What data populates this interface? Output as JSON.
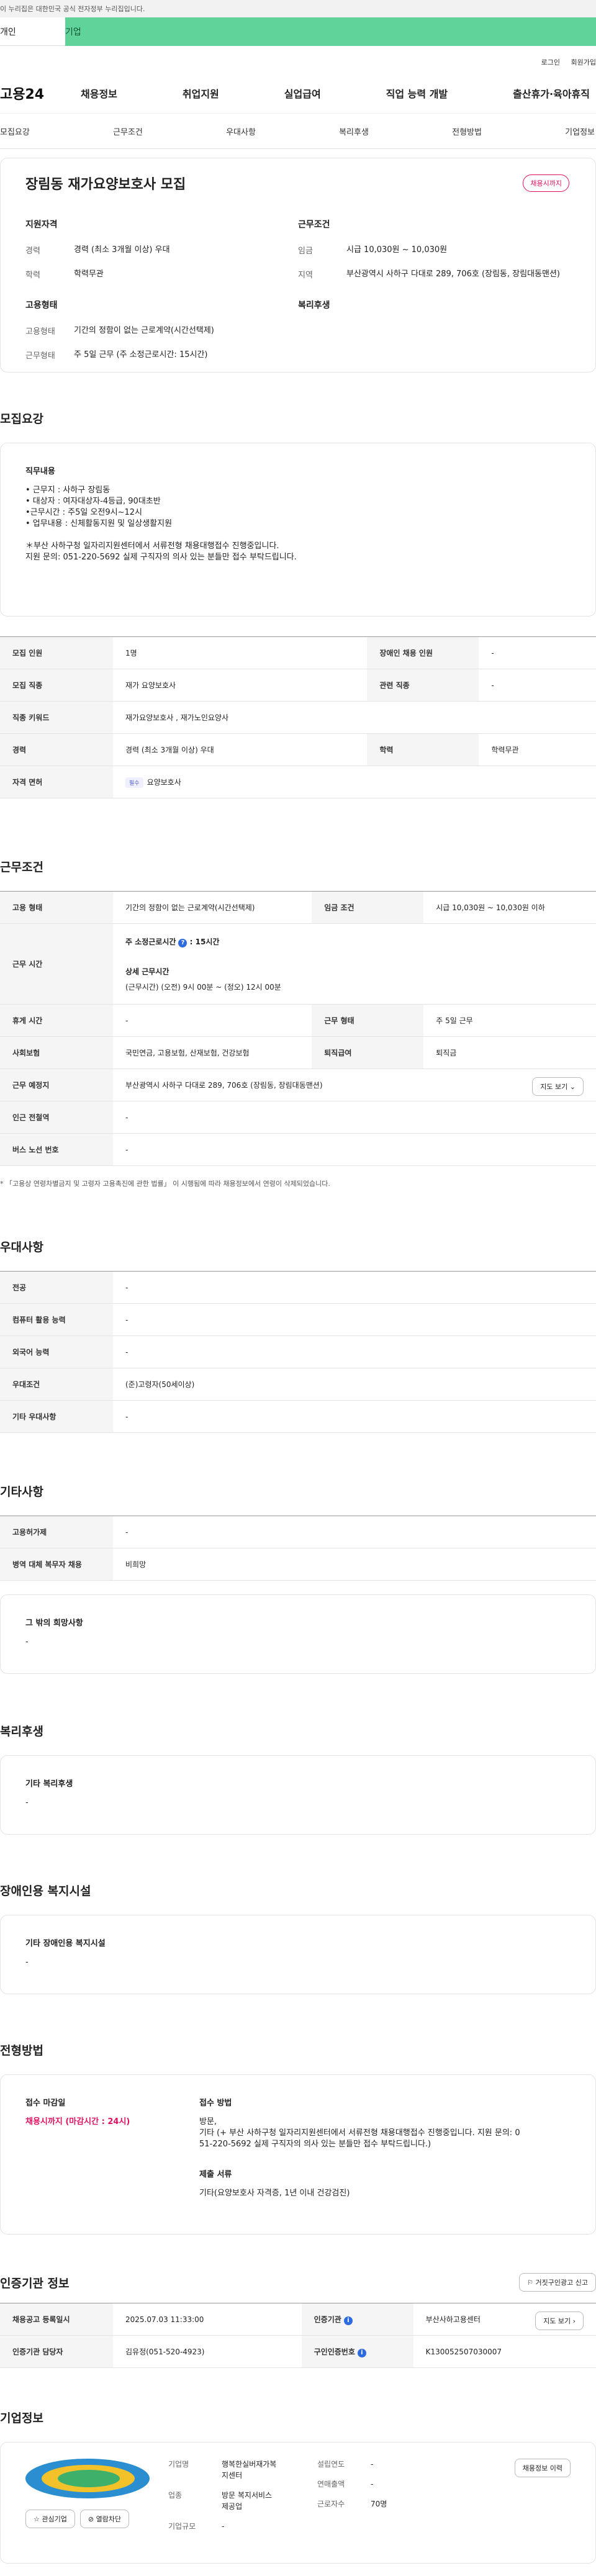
{
  "gov_bar": "이 누리집은 대한민국 공식 전자정부 누리집입니다.",
  "top_tabs": [
    "개인",
    "기업"
  ],
  "util_links": [
    "로그인",
    "회원가입"
  ],
  "logo": "고용24",
  "gnb": [
    "채용정보",
    "취업지원",
    "실업급여",
    "직업 능력 개발",
    "출산휴가·육아휴직"
  ],
  "subnav": [
    "모집요강",
    "근무조건",
    "우대사항",
    "복리후생",
    "전형방법",
    "기업정보"
  ],
  "summary": {
    "title": "장림동 재가요양보호사 모집",
    "badge": "채용시까지",
    "qual_header": "지원자격",
    "qual": [
      {
        "k": "경력",
        "v": "경력 (최소 3개월 이상) 우대"
      },
      {
        "k": "학력",
        "v": "학력무관"
      }
    ],
    "emp_header": "고용형태",
    "emp": [
      {
        "k": "고용형태",
        "v": "기간의 정함이 없는 근로계약(시간선택제)"
      },
      {
        "k": "근무형태",
        "v": "주 5일 근무 (주 소정근로시간: 15시간)"
      }
    ],
    "cond_header": "근무조건",
    "cond": [
      {
        "k": "임금",
        "v": "시급 10,030원 ~ 10,030원"
      },
      {
        "k": "지역",
        "v": "부산광역시 사하구 다대로 289, 706호 (장림동, 장림대동맨션)"
      }
    ],
    "welfare_header": "복리후생"
  },
  "recruit": {
    "section": "모집요강",
    "job_header": "직무내용",
    "job_lines": [
      "• 근무지 : 사하구 장림동",
      "• 대상자 : 여자대상자-4등급, 90대초반",
      "•근무시간 : 주5일 오전9시~12시",
      "• 업무내용 : 신체활동지원 및 일상생활지원",
      "",
      "＊부산 사하구청 일자리지원센터에서 서류전형 채용대행접수 진행중입니다.",
      "지원 문의: 051-220-5692 실제 구직자의 의사 있는 분들만 접수 부탁드립니다."
    ],
    "rows": [
      {
        "h1": "모집 인원",
        "v1": "1명",
        "h2": "장애인 채용 인원",
        "v2": "-"
      },
      {
        "h1": "모집 직종",
        "v1": "재가 요양보호사",
        "h2": "관련 직종",
        "v2": "-"
      },
      {
        "h1": "직종 키워드",
        "v1": "재가요양보호사 , 재가노인요양사"
      },
      {
        "h1": "경력",
        "v1": "경력 (최소 3개월 이상) 우대",
        "h2": "학력",
        "v2": "학력무관"
      }
    ],
    "license_h": "자격 면허",
    "license_tag": "필수",
    "license_v": "요양보호사"
  },
  "work": {
    "section": "근무조건",
    "type_h": "고용 형태",
    "type_v": "기간의 정함이 없는 근로계약(시간선택제)",
    "wage_h": "임금 조건",
    "wage_v": "시급 10,030원 ~ 10,030원 이하",
    "hours_h": "근무 시간",
    "hours_line1": "주 소정근로시간",
    "hours_line1_val": ": 15시간",
    "hours_detail_h": "상세 근무시간",
    "hours_detail_v": "(근무시간) (오전) 9시 00분 ~ (정오) 12시 00분",
    "rest_h": "휴게 시간",
    "rest_v": "-",
    "form_h": "근무 형태",
    "form_v": "주 5일 근무",
    "ins_h": "사회보험",
    "ins_v": "국민연금, 고용보험, 산재보험, 건강보험",
    "ret_h": "퇴직급여",
    "ret_v": "퇴직금",
    "place_h": "근무 예정지",
    "place_v": "부산광역시 사하구 다대로 289, 706호 (장림동, 장림대동맨션)",
    "map_btn": "지도 보기",
    "station_h": "인근 전철역",
    "station_v": "-",
    "bus_h": "버스 노선 번호",
    "bus_v": "-",
    "note": "* 「고용상 연령차별금지 및 고령자 고용촉진에 관한 법률」 이 시행됨에 따라 채용정보에서 연령이 삭제되었습니다."
  },
  "pref": {
    "section": "우대사항",
    "rows": [
      {
        "h": "전공",
        "v": "-"
      },
      {
        "h": "컴퓨터 활용 능력",
        "v": "-"
      },
      {
        "h": "외국어 능력",
        "v": "-"
      },
      {
        "h": "우대조건",
        "v": "(준)고령자(50세이상)"
      },
      {
        "h": "기타 우대사항",
        "v": "-"
      }
    ]
  },
  "etc": {
    "section": "기타사항",
    "rows": [
      {
        "h": "고용허가제",
        "v": "-"
      },
      {
        "h": "병역 대체 복무자 채용",
        "v": "비희망"
      }
    ],
    "other_h": "그 밖의 희망사항",
    "other_v": "-"
  },
  "welfare": {
    "section": "복리후생",
    "h": "기타 복리후생",
    "v": "-"
  },
  "disabled": {
    "section": "장애인용 복지시설",
    "h": "기타 장애인용 복지시설",
    "v": "-"
  },
  "process": {
    "section": "전형방법",
    "deadline_h": "접수 마감일",
    "deadline_v": "채용시까지 (마감시간 : 24시)",
    "method_h": "접수 방법",
    "method_v1": "방문,",
    "method_v2": "기타 (+ 부산 사하구청 일자리지원센터에서 서류전형 채용대행접수 진행중입니다.   지원 문의: 0",
    "method_v3": "51-220-5692 실제 구직자의 의사 있는 분들만 접수 부탁드립니다.)",
    "docs_h": "제출 서류",
    "docs_v": "기타(요양보호사 자격증, 1년 이내 건강검진)"
  },
  "agency": {
    "section": "인증기관 정보",
    "report_btn": "거짓구인광고 신고",
    "reg_h": "채용공고 등록일시",
    "reg_v": "2025.07.03 11:33:00",
    "org_h": "인증기관",
    "org_v": "부산사하고용센터",
    "map_btn": "지도 보기",
    "mgr_h": "인증기관 담당자",
    "mgr_v": "김유정(051-520-4923)",
    "no_h": "구인인증번호",
    "no_v": "K130052507030007"
  },
  "company": {
    "section": "기업정보",
    "name_k": "기업명",
    "name_v1": "행복한실버재가복",
    "name_v2": "지센터",
    "ind_k": "업종",
    "ind_v1": "방문 복지서비스",
    "ind_v2": "제공업",
    "size_k": "기업규모",
    "size_v": "-",
    "est_k": "설립연도",
    "est_v": "-",
    "rev_k": "연매출액",
    "rev_v": "-",
    "emp_k": "근로자수",
    "emp_v": "70명",
    "history_btn": "채용정보 이력",
    "fav_btn": "관심기업",
    "block_btn": "열람차단"
  },
  "colors": {
    "accent_green": "#5fd39a",
    "deadline_red": "#e0115f",
    "info_blue": "#2d6bdf"
  }
}
